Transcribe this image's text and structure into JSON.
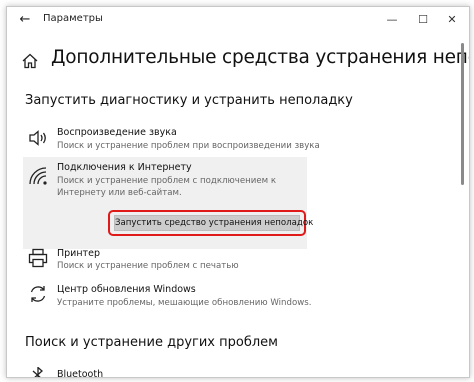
{
  "window": {
    "title": "Параметры",
    "back_symbol": "←",
    "min_symbol": "—",
    "max_symbol": "☐",
    "close_symbol": "✕"
  },
  "page": {
    "title": "Дополнительные средства устранения неполадок"
  },
  "section1": {
    "title": "Запустить диагностику и устранить неполадку",
    "items": [
      {
        "icon": "speaker-icon",
        "title": "Воспроизведение звука",
        "desc": "Поиск и устранение проблем при воспроизведении звука"
      },
      {
        "icon": "wifi-icon",
        "title": "Подключения к Интернету",
        "desc": "Поиск и устранение проблем с подключением к Интернету или веб-сайтам.",
        "button": "Запустить средство устранения неполадок"
      },
      {
        "icon": "printer-icon",
        "title": "Принтер",
        "desc": "Поиск и устранение проблем с печатью"
      },
      {
        "icon": "update-icon",
        "title": "Центр обновления Windows",
        "desc": "Устраните проблемы, мешающие обновлению Windows."
      }
    ]
  },
  "section2": {
    "title": "Поиск и устранение других проблем",
    "items": [
      {
        "icon": "bluetooth-icon",
        "title": "Bluetooth"
      }
    ]
  },
  "colors": {
    "highlight_border": "#e01919",
    "selected_bg": "#f0f0f0",
    "button_bg": "#cccccc"
  }
}
